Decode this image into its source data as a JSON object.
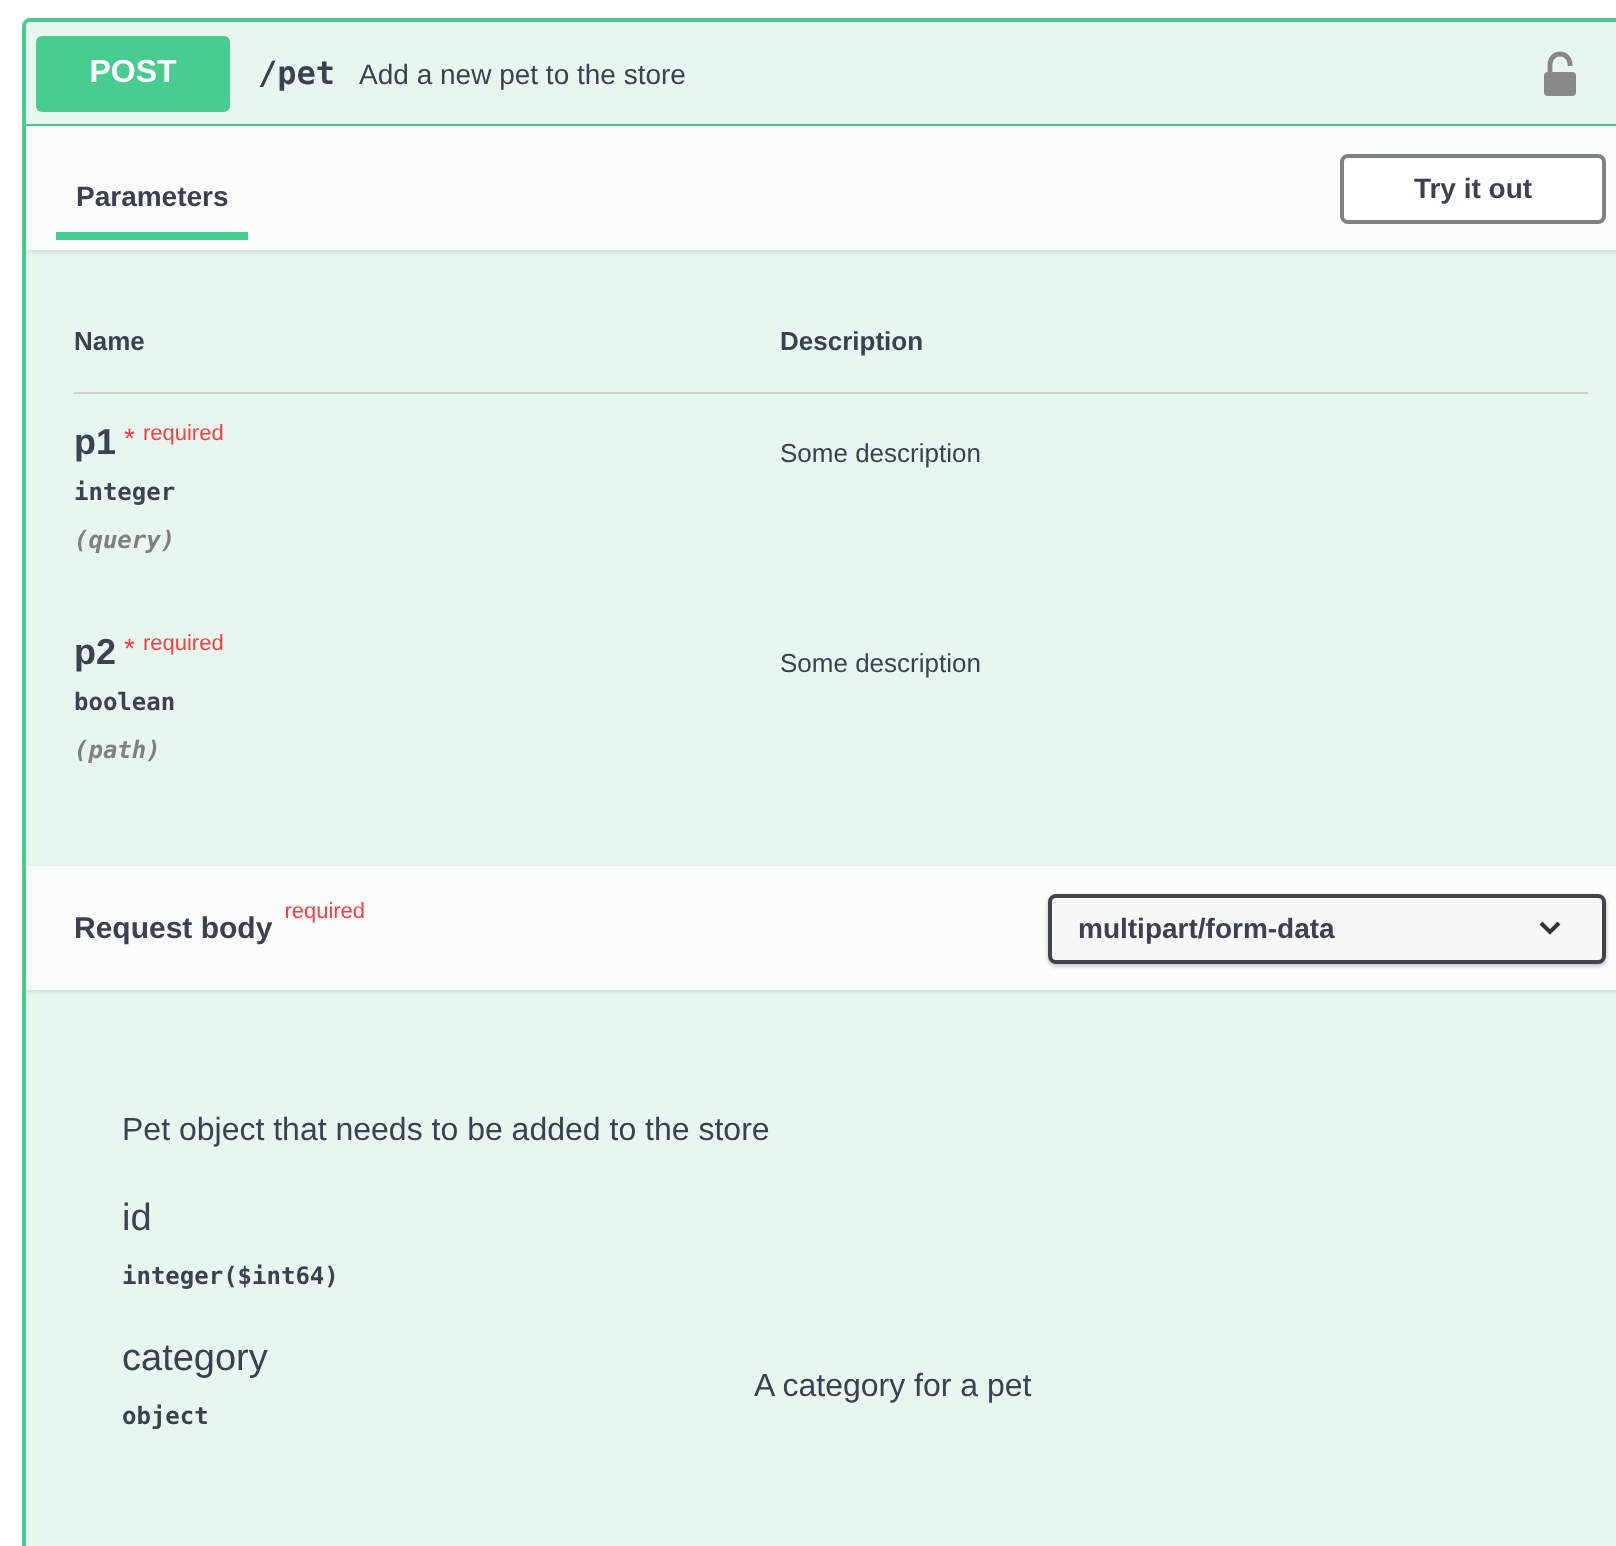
{
  "operation": {
    "method": "POST",
    "path": "/pet",
    "summary": "Add a new pet to the store"
  },
  "tabs": [
    {
      "label": "Parameters",
      "selected": true
    }
  ],
  "try_button": "Try it out",
  "parameters": {
    "columns": [
      "Name",
      "Description"
    ],
    "rows": [
      {
        "name": "p1",
        "asterisk": "*",
        "required_label": "required",
        "type": "integer",
        "location": "(query)",
        "description": "Some description"
      },
      {
        "name": "p2",
        "asterisk": "*",
        "required_label": "required",
        "type": "boolean",
        "location": "(path)",
        "description": "Some description"
      }
    ]
  },
  "request_body": {
    "title": "Request body",
    "required_label": "required",
    "content_type": "multipart/form-data"
  },
  "schema": {
    "description": "Pet object that needs to be added to the store",
    "properties": [
      {
        "name": "id",
        "type": "integer($int64)"
      },
      {
        "name": "category",
        "type": "object",
        "description": "A category for a pet"
      }
    ]
  }
}
